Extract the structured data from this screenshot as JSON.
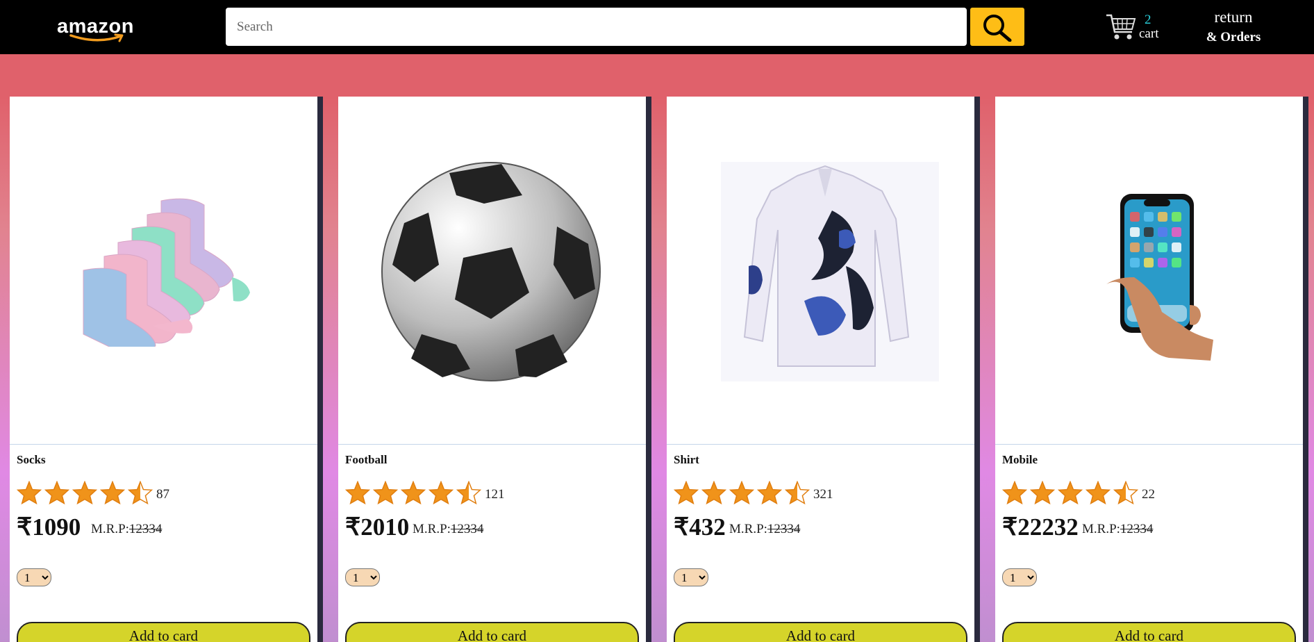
{
  "header": {
    "logo_text": "amazon",
    "search": {
      "placeholder": "Search",
      "value": ""
    },
    "cart": {
      "count": "2",
      "label": "cart"
    },
    "returns": {
      "line1": "return",
      "line2": "& Orders"
    }
  },
  "icons": {
    "search": "search-icon",
    "cart": "cart-icon",
    "star": "star-icon",
    "chevron": "chevron-down-icon"
  },
  "colors": {
    "header_bg": "#000000",
    "search_button": "#febd16",
    "cart_count": "#2ad5e0",
    "star": "#f0931a",
    "add_button": "#d5d42a",
    "qty_select": "#f7d8b4"
  },
  "products": [
    {
      "name": "Socks",
      "rating": 4.5,
      "review_count": "87",
      "price": "₹1090",
      "mrp_label": "M.R.P:",
      "mrp_value": "12334",
      "quantity": "1",
      "button_label": "Add to card",
      "image": "socks-image"
    },
    {
      "name": "Football",
      "rating": 4.5,
      "review_count": "121",
      "price": "₹2010",
      "mrp_label": "M.R.P:",
      "mrp_value": "12334",
      "quantity": "1",
      "button_label": "Add to card",
      "image": "football-image"
    },
    {
      "name": "Shirt",
      "rating": 4.5,
      "review_count": "321",
      "price": "₹432",
      "mrp_label": "M.R.P:",
      "mrp_value": "12334",
      "quantity": "1",
      "button_label": "Add to card",
      "image": "shirt-image"
    },
    {
      "name": "Mobile",
      "rating": 4.5,
      "review_count": "22",
      "price": "₹22232",
      "mrp_label": "M.R.P:",
      "mrp_value": "12334",
      "quantity": "1",
      "button_label": "Add to card",
      "image": "mobile-image"
    }
  ]
}
